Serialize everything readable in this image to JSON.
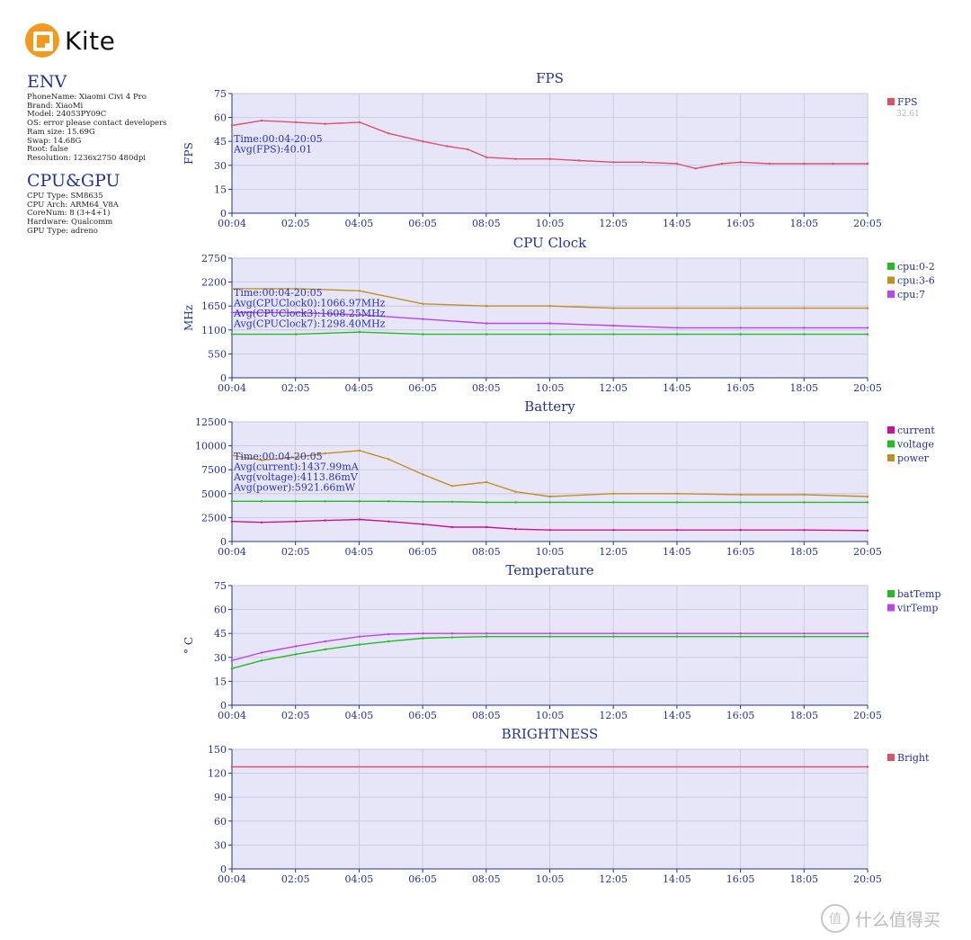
{
  "brand": {
    "name": "Kite"
  },
  "env": {
    "title": "ENV",
    "lines": [
      "PhoneName: Xiaomi Civi 4 Pro",
      "Brand: XiaoMi",
      "Model: 24053PY09C",
      "OS: error please contact developers",
      "Ram size: 15.69G",
      "Swap: 14.68G",
      "Root: false",
      "Resolution: 1236x2750 480dpi"
    ]
  },
  "cpugpu": {
    "title": "CPU&GPU",
    "lines": [
      "CPU Type: SM8635",
      "CPU Arch: ARM64_V8A",
      "CoreNum: 8 (3+4+1)",
      "Hardware: Qualcomm",
      "GPU Type: adreno"
    ]
  },
  "watermark": {
    "text": "什么值得买"
  },
  "chart_data": [
    {
      "type": "line",
      "title": "FPS",
      "ylabel": "FPS",
      "ylim": [
        0,
        75
      ],
      "yticks": [
        "0",
        "15",
        "30",
        "45",
        "60",
        "75"
      ],
      "xticks": [
        "00:04",
        "02:05",
        "04:05",
        "06:05",
        "08:05",
        "10:05",
        "12:05",
        "14:05",
        "16:05",
        "18:05",
        "20:05"
      ],
      "x": [
        "00:04",
        "01:00",
        "02:05",
        "03:00",
        "04:05",
        "05:00",
        "06:05",
        "06:50",
        "07:30",
        "08:05",
        "09:00",
        "10:05",
        "11:00",
        "12:05",
        "13:00",
        "14:05",
        "14:40",
        "15:30",
        "16:05",
        "17:00",
        "18:05",
        "19:00",
        "20:05"
      ],
      "series": [
        {
          "name": "FPS",
          "color": "#e0506a",
          "legend_value": "32.61",
          "values": [
            55,
            58,
            57,
            56,
            57,
            50,
            45,
            42,
            40,
            35,
            34,
            34,
            33,
            32,
            32,
            31,
            28,
            31,
            32,
            31,
            31,
            31,
            31
          ]
        }
      ],
      "annotations": [
        "Time:00:04-20:05",
        "Avg(FPS):40.01"
      ],
      "grid": true,
      "legend": "right"
    },
    {
      "type": "line",
      "title": "CPU Clock",
      "ylabel": "MHz",
      "ylim": [
        0,
        2750
      ],
      "yticks": [
        "0",
        "550",
        "1100",
        "1650",
        "2200",
        "2750"
      ],
      "xticks": [
        "00:04",
        "02:05",
        "04:05",
        "06:05",
        "08:05",
        "10:05",
        "12:05",
        "14:05",
        "16:05",
        "18:05",
        "20:05"
      ],
      "x": [
        "00:04",
        "02:05",
        "04:05",
        "06:05",
        "08:05",
        "10:05",
        "12:05",
        "14:05",
        "16:05",
        "18:05",
        "20:05"
      ],
      "series": [
        {
          "name": "cpu:0-2",
          "color": "#22bb22",
          "values": [
            1000,
            1000,
            1050,
            1000,
            1000,
            1000,
            1000,
            1000,
            1000,
            1000,
            1000
          ]
        },
        {
          "name": "cpu:3-6",
          "color": "#c09020",
          "values": [
            2050,
            2050,
            2000,
            1700,
            1650,
            1650,
            1600,
            1600,
            1600,
            1600,
            1600
          ]
        },
        {
          "name": "cpu:7",
          "color": "#bb44ee",
          "values": [
            1500,
            1500,
            1450,
            1350,
            1250,
            1250,
            1200,
            1150,
            1150,
            1150,
            1150
          ]
        }
      ],
      "annotations": [
        "Time:00:04-20:05",
        "Avg(CPUClock0):1066.97MHz",
        "Avg(CPUClock3):1608.25MHz",
        "Avg(CPUClock7):1298.40MHz"
      ],
      "grid": true,
      "legend": "right"
    },
    {
      "type": "line",
      "title": "Battery",
      "ylabel": "",
      "ylim": [
        0,
        12500
      ],
      "yticks": [
        "0",
        "2500",
        "5000",
        "7500",
        "10000",
        "12500"
      ],
      "xticks": [
        "00:04",
        "02:05",
        "04:05",
        "06:05",
        "08:05",
        "10:05",
        "12:05",
        "14:05",
        "16:05",
        "18:05",
        "20:05"
      ],
      "x": [
        "00:04",
        "01:00",
        "02:05",
        "03:00",
        "04:05",
        "05:00",
        "06:05",
        "07:00",
        "08:05",
        "09:00",
        "10:05",
        "12:05",
        "14:05",
        "16:05",
        "18:05",
        "20:05"
      ],
      "series": [
        {
          "name": "current",
          "color": "#cc1199",
          "values": [
            2100,
            2000,
            2100,
            2200,
            2300,
            2100,
            1800,
            1500,
            1500,
            1300,
            1200,
            1200,
            1200,
            1200,
            1200,
            1150
          ]
        },
        {
          "name": "voltage",
          "color": "#22bb22",
          "values": [
            4200,
            4200,
            4200,
            4200,
            4200,
            4200,
            4150,
            4150,
            4100,
            4100,
            4100,
            4100,
            4100,
            4100,
            4100,
            4100
          ]
        },
        {
          "name": "power",
          "color": "#c09020",
          "values": [
            9000,
            8500,
            8800,
            9200,
            9500,
            8600,
            7000,
            5800,
            6200,
            5200,
            4700,
            5000,
            5000,
            4900,
            4900,
            4700
          ]
        }
      ],
      "annotations": [
        "Time:00:04-20:05",
        "Avg(current):1437.99mA",
        "Avg(voltage):4113.86mV",
        "Avg(power):5921.66mW"
      ],
      "grid": true,
      "legend": "right"
    },
    {
      "type": "line",
      "title": "Temperature",
      "ylabel": "° C",
      "ylim": [
        0,
        75
      ],
      "yticks": [
        "0",
        "15",
        "30",
        "45",
        "60",
        "75"
      ],
      "xticks": [
        "00:04",
        "02:05",
        "04:05",
        "06:05",
        "08:05",
        "10:05",
        "12:05",
        "14:05",
        "16:05",
        "18:05",
        "20:05"
      ],
      "x": [
        "00:04",
        "01:00",
        "02:05",
        "03:00",
        "04:05",
        "05:00",
        "06:05",
        "07:00",
        "08:05",
        "10:05",
        "12:05",
        "14:05",
        "16:05",
        "18:05",
        "20:05"
      ],
      "series": [
        {
          "name": "batTemp",
          "color": "#22bb22",
          "values": [
            23,
            28,
            32,
            35,
            38,
            40,
            42,
            42.5,
            43,
            43,
            43,
            43,
            43,
            43,
            43
          ]
        },
        {
          "name": "virTemp",
          "color": "#bb44ee",
          "values": [
            28,
            33,
            37,
            40,
            43,
            44.5,
            45,
            45,
            45,
            45,
            45,
            45,
            45,
            45,
            45
          ]
        }
      ],
      "annotations": [],
      "grid": true,
      "legend": "right"
    },
    {
      "type": "line",
      "title": "BRIGHTNESS",
      "ylabel": "",
      "ylim": [
        0,
        150
      ],
      "yticks": [
        "0",
        "30",
        "60",
        "90",
        "120",
        "150"
      ],
      "xticks": [
        "00:04",
        "02:05",
        "04:05",
        "06:05",
        "08:05",
        "10:05",
        "12:05",
        "14:05",
        "16:05",
        "18:05",
        "20:05"
      ],
      "x": [
        "00:04",
        "20:05"
      ],
      "series": [
        {
          "name": "Bright",
          "color": "#e0506a",
          "values": [
            128,
            128
          ]
        }
      ],
      "annotations": [],
      "grid": true,
      "legend": "right"
    }
  ]
}
